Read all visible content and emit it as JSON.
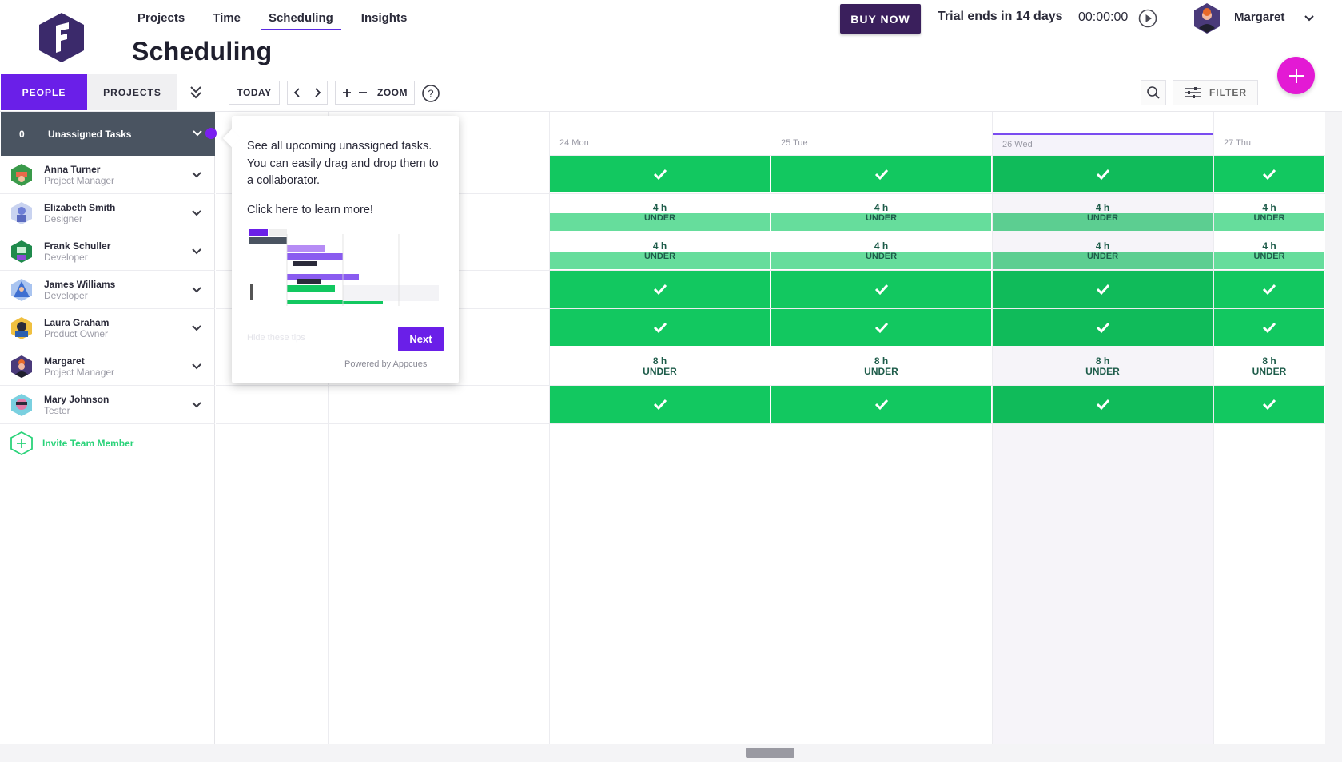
{
  "nav": {
    "items": [
      {
        "label": "Projects",
        "active": false
      },
      {
        "label": "Time",
        "active": false
      },
      {
        "label": "Scheduling",
        "active": true
      },
      {
        "label": "Insights",
        "active": false
      }
    ]
  },
  "page": {
    "title": "Scheduling"
  },
  "header": {
    "buy_now": "BUY NOW",
    "trial": "Trial ends in 14 days",
    "timer": "00:00:00",
    "user_name": "Margaret"
  },
  "toolbar": {
    "people_tab": "PEOPLE",
    "projects_tab": "PROJECTS",
    "today": "TODAY",
    "zoom": "ZOOM",
    "filter": "FILTER"
  },
  "unassigned": {
    "count": "0",
    "label": "Unassigned Tasks"
  },
  "people": [
    {
      "name": "Anna Turner",
      "role": "Project Manager",
      "avatar_color": "#3a9a4a"
    },
    {
      "name": "Elizabeth Smith",
      "role": "Designer",
      "avatar_color": "#6e7fd6"
    },
    {
      "name": "Frank Schuller",
      "role": "Developer",
      "avatar_color": "#1f8a4c"
    },
    {
      "name": "James Williams",
      "role": "Developer",
      "avatar_color": "#3d6fd1"
    },
    {
      "name": "Laura Graham",
      "role": "Product Owner",
      "avatar_color": "#2b5fb0"
    },
    {
      "name": "Margaret",
      "role": "Project Manager",
      "avatar_color": "#4a3a7a"
    },
    {
      "name": "Mary Johnson",
      "role": "Tester",
      "avatar_color": "#e27aa8"
    }
  ],
  "invite": {
    "label": "Invite Team Member"
  },
  "calendar": {
    "days": [
      {
        "label": "24 Mon",
        "today": false
      },
      {
        "label": "25 Tue",
        "today": false
      },
      {
        "label": "26 Wed",
        "today": true
      },
      {
        "label": "27 Thu",
        "today": false
      }
    ],
    "rows": [
      {
        "type": "full"
      },
      {
        "type": "under-split",
        "hours": "4 h",
        "status": "UNDER"
      },
      {
        "type": "under-split",
        "hours": "4 h",
        "status": "UNDER"
      },
      {
        "type": "full"
      },
      {
        "type": "full"
      },
      {
        "type": "under-plain",
        "hours": "8 h",
        "status": "UNDER"
      },
      {
        "type": "full"
      }
    ]
  },
  "tooltip": {
    "text1": "See all upcoming unassigned tasks. You can easily drag and drop them to a collaborator.",
    "text2": "Click here to learn more!",
    "hide_tips": "Hide these tips",
    "next": "Next",
    "powered": "Powered by Appcues"
  },
  "colors": {
    "brand_purple": "#6a1fe8",
    "buy_now_bg": "#3a1f5c",
    "fab_magenta": "#e31ad4",
    "capacity_full": "#12c860",
    "capacity_under": "#66dd9c",
    "invite_green": "#2bd37a"
  }
}
